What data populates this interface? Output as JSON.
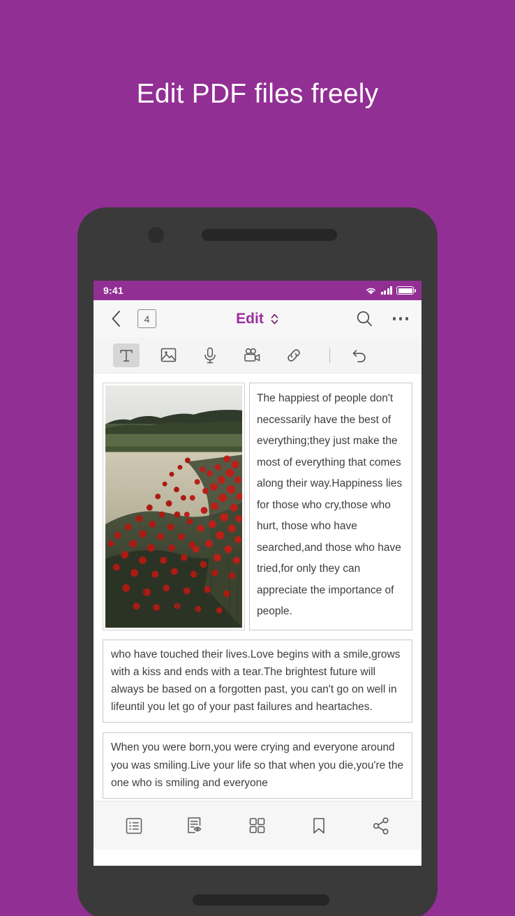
{
  "promo": {
    "headline": "Edit PDF files freely",
    "background_color": "#922f94",
    "accent_color": "#9b2d9e"
  },
  "status_bar": {
    "time": "9:41",
    "wifi_icon": "wifi-icon",
    "signal_icon": "cellular-signal-icon",
    "battery_icon": "battery-full-icon"
  },
  "nav_bar": {
    "back_icon": "chevron-left-icon",
    "page_number": "4",
    "title": "Edit",
    "mode_switch_icon": "chevron-up-down-icon",
    "search_icon": "search-icon",
    "more_icon": "more-horizontal-icon"
  },
  "tool_bar": {
    "tools": [
      {
        "name": "text-tool",
        "icon": "text-icon",
        "label": "T",
        "active": true
      },
      {
        "name": "image-tool",
        "icon": "image-icon",
        "label": "Image",
        "active": false
      },
      {
        "name": "audio-tool",
        "icon": "microphone-icon",
        "label": "Audio",
        "active": false
      },
      {
        "name": "video-tool",
        "icon": "video-camera-icon",
        "label": "Video",
        "active": false
      },
      {
        "name": "link-tool",
        "icon": "link-icon",
        "label": "Link",
        "active": false
      },
      {
        "name": "undo-tool",
        "icon": "undo-icon",
        "label": "Undo",
        "active": false
      }
    ]
  },
  "document": {
    "photo": {
      "name": "poppy-field-photo",
      "description": "Field of red poppies beside a wheat field with treeline and overcast sky"
    },
    "column_text": "The happiest of people don't necessarily have the best of everything;they just make the most of everything that comes along their way.Happiness lies for those who cry,those who hurt, those who have searched,and those who have tried,for only they can appreciate the importance of people.",
    "block_two_text": "who have touched their lives.Love begins with a smile,grows with a kiss and ends with a tear.The brightest future will always be based on a forgotten past, you can't go on well in lifeuntil you let go of your past failures and heartaches.",
    "block_three_text": "When you were born,you were crying and everyone around you was smiling.Live your life so that when you die,you're the one who is smiling and everyone"
  },
  "tab_bar": {
    "tabs": [
      {
        "name": "tab-outline",
        "icon": "list-outline-icon",
        "label": "Outline"
      },
      {
        "name": "tab-read-mode",
        "icon": "document-eye-icon",
        "label": "Read Mode"
      },
      {
        "name": "tab-thumbnails",
        "icon": "grid-icon",
        "label": "Thumbnails"
      },
      {
        "name": "tab-bookmark",
        "icon": "bookmark-icon",
        "label": "Bookmark"
      },
      {
        "name": "tab-share",
        "icon": "share-icon",
        "label": "Share"
      }
    ]
  }
}
